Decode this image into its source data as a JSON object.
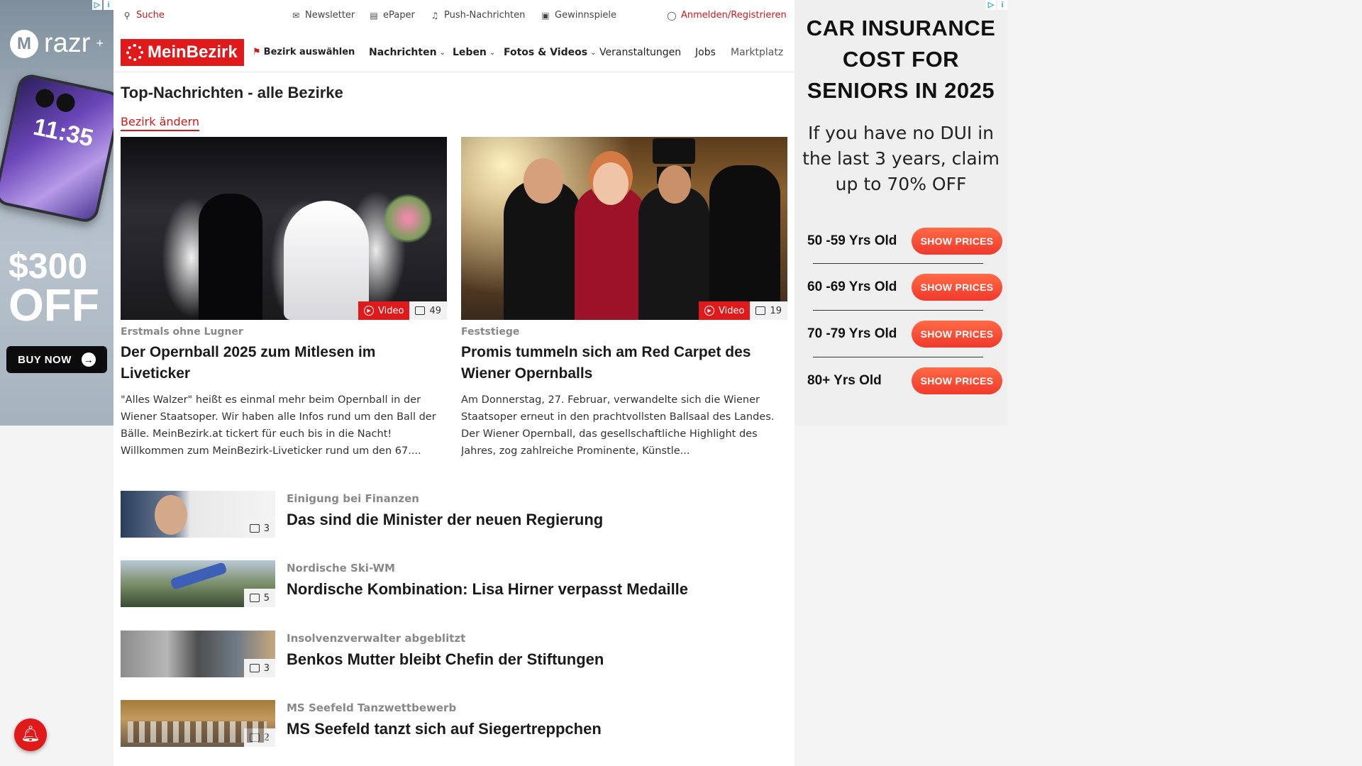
{
  "ad_left": {
    "brand": "razr",
    "brand_sup": "+",
    "phone_time": "11:35",
    "offer_amount": "$300",
    "offer_word": "OFF",
    "cta": "BUY NOW"
  },
  "topbar": {
    "search": "Suche",
    "newsletter": "Newsletter",
    "epaper": "ePaper",
    "push": "Push-Nachrichten",
    "gewinnspiele": "Gewinnspiele",
    "login": "Anmelden/Registrieren"
  },
  "nav": {
    "logo": "MeinBezirk",
    "bezirk": "Bezirk auswählen",
    "items": [
      "Nachrichten",
      "Leben",
      "Fotos & Videos",
      "Veranstaltungen",
      "Jobs",
      "Marktplatz"
    ]
  },
  "page": {
    "title": "Top-Nachrichten - alle Bezirke",
    "change_link": "Bezirk ändern"
  },
  "features": [
    {
      "kicker": "Erstmals ohne Lugner",
      "title": "Der Opernball 2025 zum Mitlesen im Liveticker",
      "teaser": "\"Alles Walzer\" heißt es einmal mehr beim Opernball in der Wiener Staatsoper. Wir haben alle Infos rund um den Ball der Bälle. MeinBezirk.at tickert für euch bis in die Nacht! Willkommen zum MeinBezirk-Liveticker rund um den 67....",
      "video_label": "Video",
      "photo_count": "49"
    },
    {
      "kicker": "Feststiege",
      "title": "Promis tummeln sich am Red Carpet des Wiener Opernballs",
      "teaser": "Am Donnerstag, 27. Februar, verwandelte sich die Wiener Staatsoper erneut in den prachtvollsten Ballsaal des Landes. Der Wiener Opernball, das gesellschaftliche Highlight des Jahres, zog zahlreiche Prominente, Künstle...",
      "video_label": "Video",
      "photo_count": "19"
    }
  ],
  "rows": [
    {
      "kicker": "Einigung bei Finanzen",
      "title": "Das sind die Minister der neuen Regierung",
      "photo_count": "3"
    },
    {
      "kicker": "Nordische Ski-WM",
      "title": "Nordische Kombination: Lisa Hirner verpasst Medaille",
      "photo_count": "5"
    },
    {
      "kicker": "Insolvenzverwalter abgeblitzt",
      "title": "Benkos Mutter bleibt Chefin der Stiftungen",
      "photo_count": "3"
    },
    {
      "kicker": "MS Seefeld Tanzwettbewerb",
      "title": "MS Seefeld tanzt sich auf Siegertreppchen",
      "photo_count": "2"
    }
  ],
  "ad_right": {
    "headline_1": "CAR INSURANCE",
    "headline_2": "COST FOR",
    "headline_3": "SENIORS IN 2025",
    "sub_1": "If you have no DUI in",
    "sub_2": "the last 3 years, claim",
    "sub_3": "up to 70% OFF",
    "rows": [
      {
        "age": "50 -59 Yrs Old",
        "cta": "SHOW PRICES"
      },
      {
        "age": "60 -69 Yrs Old",
        "cta": "SHOW PRICES"
      },
      {
        "age": "70 -79 Yrs Old",
        "cta": "SHOW PRICES"
      },
      {
        "age": "80+ Yrs Old",
        "cta": "SHOW PRICES"
      }
    ]
  },
  "colors": {
    "brand_red": "#e01a1a",
    "link_red": "#d31818",
    "cta_orange": "#f0392c"
  }
}
